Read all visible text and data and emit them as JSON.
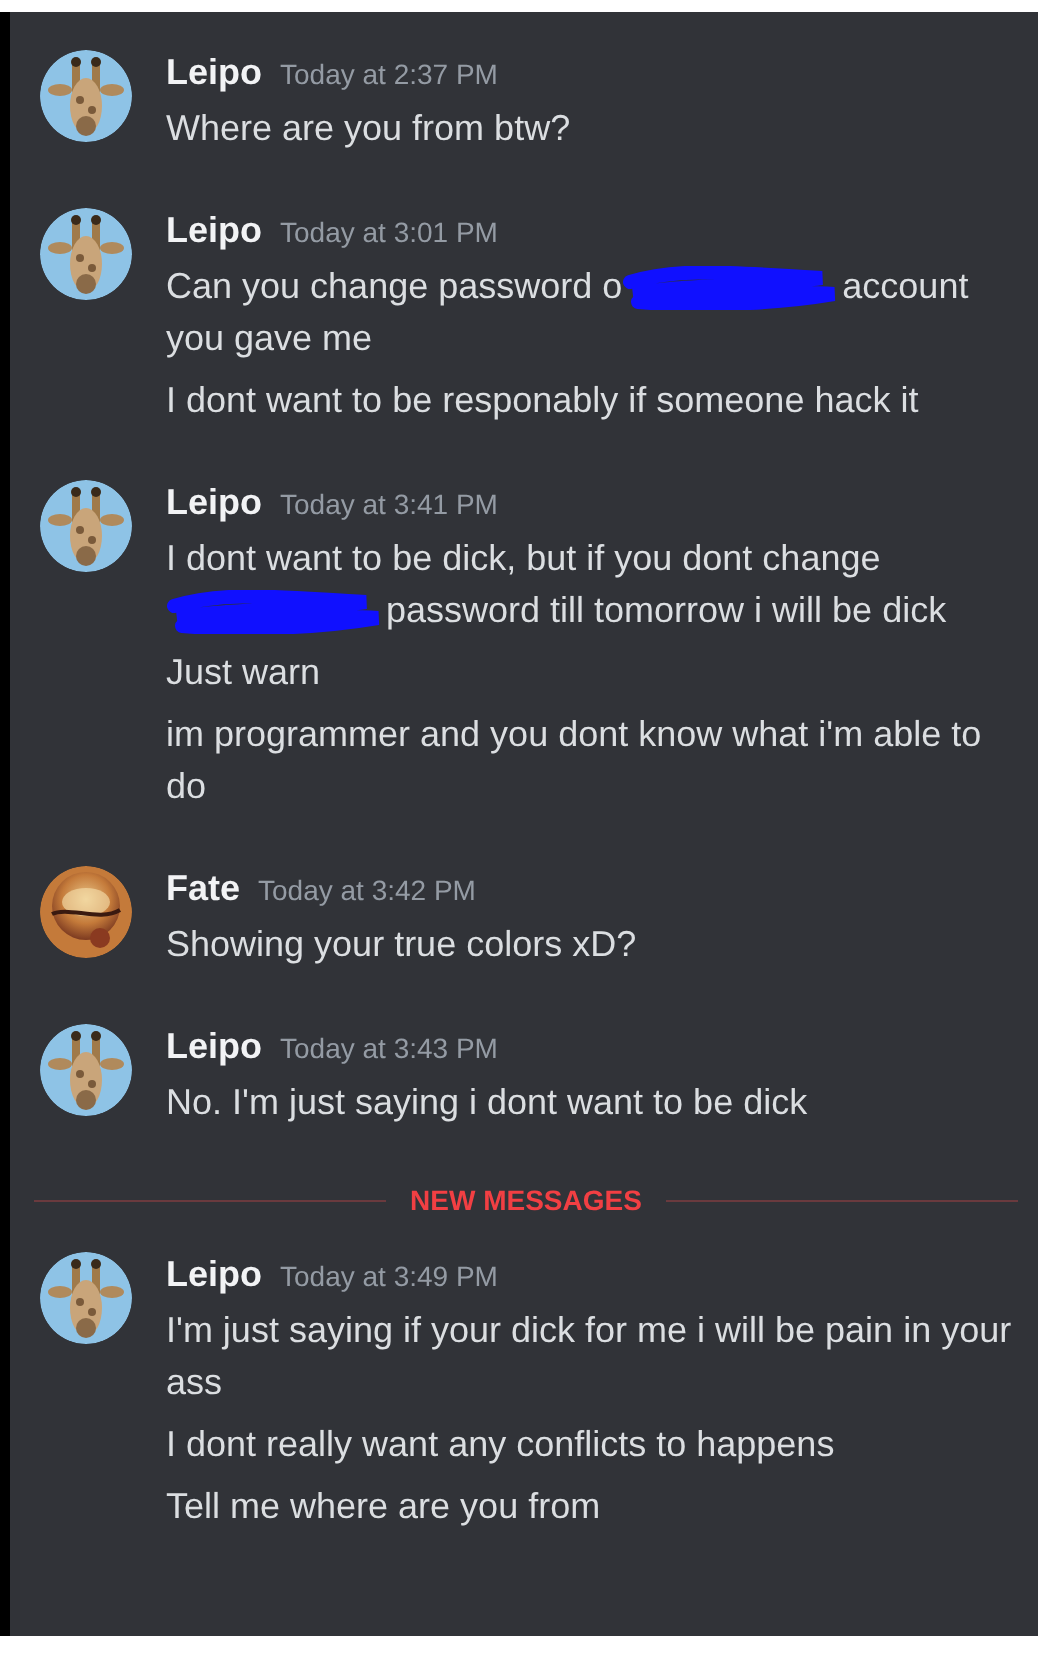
{
  "feed": [
    {
      "kind": "message",
      "avatar": {
        "kind": "picture",
        "color": "#8ec3e6"
      },
      "author": "Leipo",
      "timestamp": "Today at 2:37 PM",
      "paragraphs": [
        [
          {
            "kind": "text",
            "text": "Where are you from btw?"
          }
        ]
      ]
    },
    {
      "kind": "message",
      "avatar": {
        "kind": "picture",
        "color": "#8ec3e6"
      },
      "author": "Leipo",
      "timestamp": "Today at 3:01 PM",
      "paragraphs": [
        [
          {
            "kind": "text",
            "text": "Can you change password o"
          },
          {
            "kind": "redaction"
          },
          {
            "kind": "text",
            "text": "account you gave me"
          }
        ],
        [
          {
            "kind": "text",
            "text": "I dont want to be responably if someone hack it"
          }
        ]
      ]
    },
    {
      "kind": "message",
      "avatar": {
        "kind": "picture",
        "color": "#8ec3e6"
      },
      "author": "Leipo",
      "timestamp": "Today at 3:41 PM",
      "paragraphs": [
        [
          {
            "kind": "text",
            "text": "I dont want to be dick, but if you dont change "
          },
          {
            "kind": "redaction"
          },
          {
            "kind": "text",
            "text": "password till tomorrow i will be dick"
          }
        ],
        [
          {
            "kind": "text",
            "text": "Just warn"
          }
        ],
        [
          {
            "kind": "text",
            "text": "im programmer and you dont know what i'm able to do"
          }
        ]
      ]
    },
    {
      "kind": "message",
      "avatar": {
        "kind": "picture",
        "color": "#c47a3a"
      },
      "author": "Fate",
      "timestamp": "Today at 3:42 PM",
      "paragraphs": [
        [
          {
            "kind": "text",
            "text": "Showing your true colors xD?"
          }
        ]
      ]
    },
    {
      "kind": "message",
      "avatar": {
        "kind": "picture",
        "color": "#8ec3e6"
      },
      "author": "Leipo",
      "timestamp": "Today at 3:43 PM",
      "paragraphs": [
        [
          {
            "kind": "text",
            "text": "No. I'm just saying i dont want to be dick"
          }
        ]
      ]
    },
    {
      "kind": "divider",
      "label": "NEW MESSAGES"
    },
    {
      "kind": "message",
      "avatar": {
        "kind": "picture",
        "color": "#8ec3e6"
      },
      "author": "Leipo",
      "timestamp": "Today at 3:49 PM",
      "paragraphs": [
        [
          {
            "kind": "text",
            "text": "I'm just saying if your dick for me i will be pain in your ass"
          }
        ],
        [
          {
            "kind": "text",
            "text": "I dont really want any conflicts to happens"
          }
        ],
        [
          {
            "kind": "text",
            "text": "Tell me where are you from"
          }
        ]
      ]
    }
  ]
}
